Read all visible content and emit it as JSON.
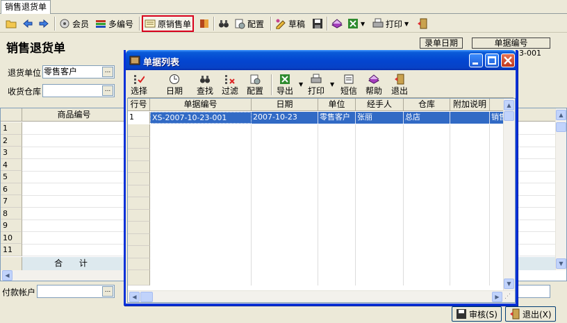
{
  "tab": {
    "label": "销售退货单"
  },
  "toolbar": {
    "member": "会员",
    "multi_code": "多编号",
    "original_sales": "原销售单",
    "config": "配置",
    "draft": "草稿",
    "print": "打印"
  },
  "form": {
    "title": "销售退货单",
    "return_unit_label": "退货单位",
    "return_unit_value": "零售客户",
    "warehouse_label": "收货仓库",
    "warehouse_value": "",
    "entry_date_label": "录单日期",
    "doc_no_label": "单据编号",
    "doc_no_value_partial": "23-001",
    "ellipsis": "..."
  },
  "grid": {
    "col_product_code": "商品编号",
    "rows": [
      "1",
      "2",
      "3",
      "4",
      "5",
      "6",
      "7",
      "8",
      "9",
      "10",
      "11"
    ],
    "total_label": "合 计"
  },
  "footer": {
    "payment_account_label": "付款帐户",
    "audit": "审核(S)",
    "exit": "退出(X)"
  },
  "modal": {
    "title": "单据列表",
    "toolbar": {
      "select": "选择",
      "date": "日期",
      "find": "查找",
      "filter": "过滤",
      "config": "配置",
      "export": "导出",
      "print": "打印",
      "sms": "短信",
      "help": "帮助",
      "exit": "退出"
    },
    "columns": [
      "行号",
      "单据编号",
      "日期",
      "单位",
      "经手人",
      "仓库",
      "附加说明",
      ""
    ],
    "rows": [
      {
        "row": "1",
        "doc_no": "XS-2007-10-23-001",
        "date": "2007-10-23",
        "unit": "零售客户",
        "handler": "张丽",
        "warehouse": "总店",
        "note": "",
        "extra": "销售"
      }
    ]
  },
  "colors": {
    "accent": "#0a5bd8",
    "selection": "#316ac5",
    "highlight_border": "#d8001c"
  }
}
